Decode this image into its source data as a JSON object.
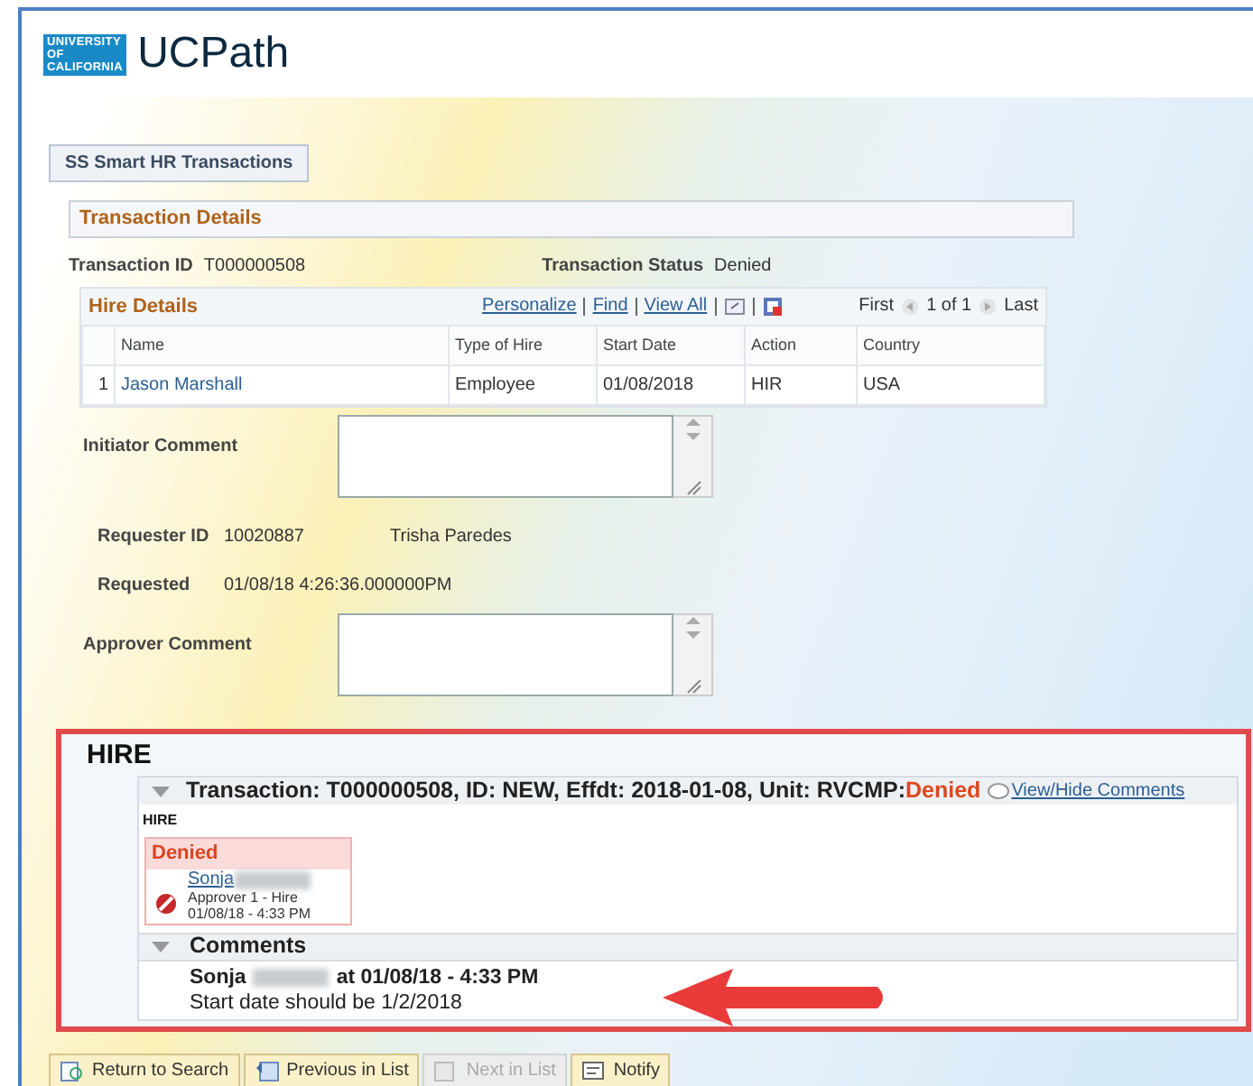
{
  "header": {
    "logo_lines": [
      "UNIVERSITY",
      "OF",
      "CALIFORNIA"
    ],
    "title": "UCPath"
  },
  "tabs": [
    {
      "label": "SS Smart HR Transactions",
      "selected": true
    }
  ],
  "section_title": "Transaction Details",
  "transaction": {
    "id_label": "Transaction ID",
    "id": "T000000508",
    "status_label": "Transaction Status",
    "status": "Denied"
  },
  "hire_details": {
    "title": "Hire Details",
    "nav_links": [
      "Personalize",
      "Find",
      "View All"
    ],
    "first": "First",
    "count": "1 of 1",
    "last": "Last",
    "columns": [
      "Name",
      "Type of Hire",
      "Start Date",
      "Action",
      "Country"
    ],
    "rows": [
      {
        "row_number": "1",
        "cells": [
          "Jason Marshall",
          "Employee",
          "01/08/2018",
          "HIR",
          "USA"
        ]
      }
    ]
  },
  "initiator_comment": {
    "label": "Initiator Comment"
  },
  "requester": {
    "id_label": "Requester ID",
    "id": "10020887",
    "name": "Trisha Paredes",
    "requested_label": "Requested",
    "requested": "01/08/18  4:26:36.000000PM"
  },
  "approver_comment": {
    "label": "Approver Comment"
  },
  "approval": {
    "title": "HIRE",
    "transaction_header": "Transaction: T000000508, ID: NEW, Effdt: 2018-01-08, Unit: RVCMP:",
    "status": "Denied",
    "toggle_link": "View/Hide Comments",
    "expanded": true,
    "step_label": "HIRE",
    "step_status": "Denied",
    "approver": {
      "name": "Sonja",
      "surname_redacted": true,
      "role": "Approver 1 - Hire",
      "date": "01/08/18 - 4:33 PM"
    },
    "comments_title": "Comments",
    "comments_expanded": true,
    "comments": [
      {
        "author": "Sonja",
        "surname_redacted": true,
        "when": "at 01/08/18 - 4:33 PM",
        "text": "Start date should be 1/2/2018"
      }
    ]
  },
  "buttons": [
    {
      "label": "Return to Search",
      "kind": "search",
      "disabled": false
    },
    {
      "label": "Previous in List",
      "kind": "previous",
      "disabled": false
    },
    {
      "label": "Next in List",
      "kind": "next",
      "disabled": true
    },
    {
      "label": "Notify",
      "kind": "notify",
      "disabled": false
    }
  ]
}
